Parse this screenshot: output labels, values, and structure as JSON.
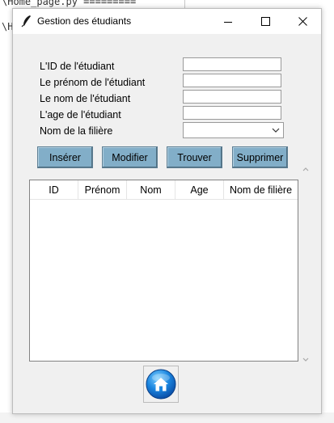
{
  "background": {
    "line1": "\\Home_page.py =========",
    "line2": "\\H"
  },
  "window": {
    "title": "Gestion des étudiants"
  },
  "form": {
    "id_label": "L'ID de l'étudiant",
    "prenom_label": "Le prénom de l'étudiant",
    "nom_label": "Le nom de l'étudiant",
    "age_label": "L'age de l'étudiant",
    "filiere_label": "Nom de la filière",
    "id_value": "",
    "prenom_value": "",
    "nom_value": "",
    "age_value": "",
    "filiere_selected": ""
  },
  "buttons": {
    "insert": "Insérer",
    "modify": "Modifier",
    "find": "Trouver",
    "delete": "Supprimer"
  },
  "table": {
    "columns": [
      "ID",
      "Prénom",
      "Nom",
      "Age",
      "Nom de filière"
    ],
    "rows": []
  },
  "colors": {
    "button_bg": "#82aec8",
    "window_bg": "#f0f0f0"
  },
  "icons": {
    "app": "feather-icon",
    "home": "home-icon"
  }
}
